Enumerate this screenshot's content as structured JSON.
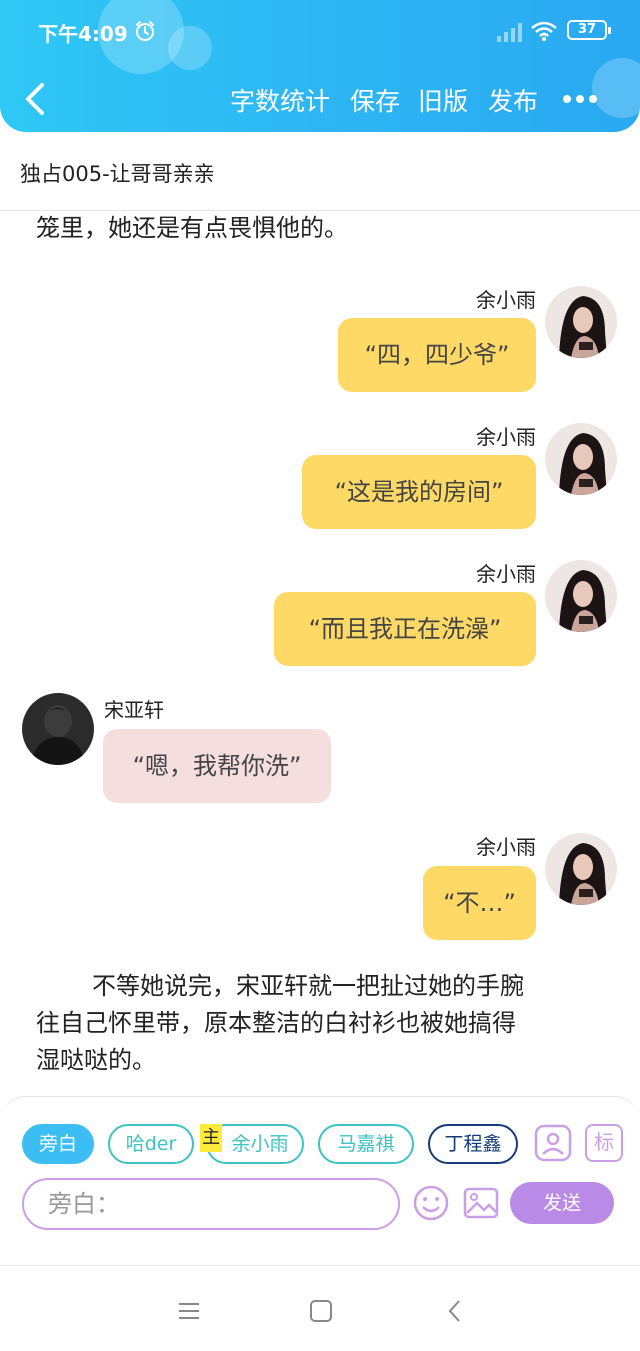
{
  "status_bar": {
    "time": "下午4:09",
    "battery": "37"
  },
  "toolbar": {
    "actions": [
      "字数统计",
      "保存",
      "旧版",
      "发布"
    ]
  },
  "document": {
    "title": "独占005-让哥哥亲亲"
  },
  "content": {
    "narration_top": "笼里，她还是有点畏惧他的。",
    "messages": [
      {
        "speaker": "余小雨",
        "text": "“四，四少爷”",
        "side": "right"
      },
      {
        "speaker": "余小雨",
        "text": "“这是我的房间”",
        "side": "right"
      },
      {
        "speaker": "余小雨",
        "text": "“而且我正在洗澡”",
        "side": "right"
      },
      {
        "speaker": "宋亚轩",
        "text": "“嗯，我帮你洗”",
        "side": "left"
      },
      {
        "speaker": "余小雨",
        "text": "“不…”",
        "side": "right"
      }
    ],
    "narration_bottom": [
      "不等她说完，宋亚轩就一把扯过她的手腕",
      "往自己怀里带，原本整洁的白衬衫也被她搞得",
      "湿哒哒的。"
    ]
  },
  "composer": {
    "chips": [
      "旁白",
      "哈der",
      "余小雨",
      "马嘉祺",
      "丁程鑫"
    ],
    "host_tag": "主",
    "mark_label": "标",
    "input_placeholder": "旁白：",
    "send_label": "发送"
  },
  "colors": {
    "header": "#2db6f3",
    "bubble_right": "#ffd965",
    "bubble_left": "#f5dede",
    "send_button": "#b98ae6"
  }
}
